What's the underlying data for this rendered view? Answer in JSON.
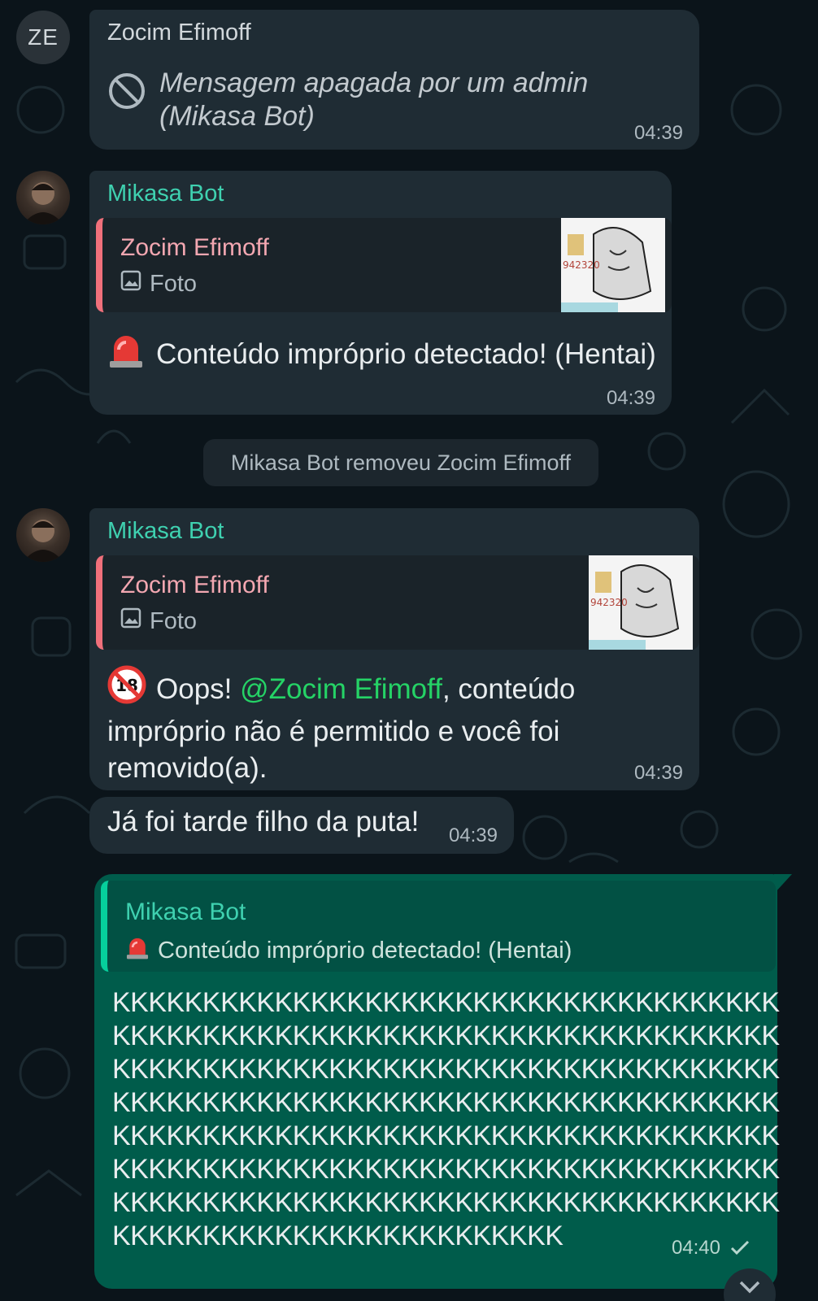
{
  "messages": {
    "deleted": {
      "avatar_initials": "ZE",
      "sender": "Zocim Efimoff",
      "text": "Mensagem apagada por um admin (Mikasa Bot)",
      "time": "04:39",
      "icon": "blocked-icon"
    },
    "bot1": {
      "sender": "Mikasa Bot",
      "quote_name": "Zocim Efimoff",
      "quote_type": "Foto",
      "thumb_caption": "942320",
      "emoji": "siren-icon",
      "text": "Conteúdo impróprio detectado! (Hentai)",
      "time": "04:39"
    },
    "system": {
      "text": "Mikasa Bot removeu Zocim Efimoff"
    },
    "bot2": {
      "sender": "Mikasa Bot",
      "quote_name": "Zocim Efimoff",
      "quote_type": "Foto",
      "thumb_caption": "942320",
      "emoji": "no-under-18-icon",
      "text_before": "Oops! ",
      "mention": "@Zocim Efimoff",
      "text_after": ", conteúdo",
      "line2": "impróprio não é permitido e você foi",
      "line3": "removido(a).",
      "time": "04:39"
    },
    "short": {
      "text": "Já foi tarde filho da puta!",
      "time": "04:39"
    },
    "outgoing": {
      "quote_name": "Mikasa Bot",
      "quote_text": "Conteúdo impróprio detectado! (Hentai)",
      "lines": [
        "KKKKKKKKKKKKKKKKKKKKKKKKKKKKKKKKKKKKK",
        "KKKKKKKKKKKKKKKKKKKKKKKKKKKKKKKKKKKKK",
        "KKKKKKKKKKKKKKKKKKKKKKKKKKKKKKKKKKKKK",
        "KKKKKKKKKKKKKKKKKKKKKKKKKKKKKKKKKKKKK",
        "KKKKKKKKKKKKKKKKKKKKKKKKKKKKKKKKKKKKK",
        "KKKKKKKKKKKKKKKKKKKKKKKKKKKKKKKKKKKKK",
        "KKKKKKKKKKKKKKKKKKKKKKKKKKKKKKKKKKKKK",
        "KKKKKKKKKKKKKKKKKKKKKKKKK"
      ],
      "time": "04:40",
      "status_icon": "single-check-icon"
    }
  },
  "colors": {
    "background": "#0b141a",
    "incoming_bubble": "#1f2c34",
    "outgoing_bubble": "#005c4b",
    "sender_teal": "#3fd1b0",
    "quote_accent_pink": "#f0707b",
    "mention_green": "#25d366"
  }
}
